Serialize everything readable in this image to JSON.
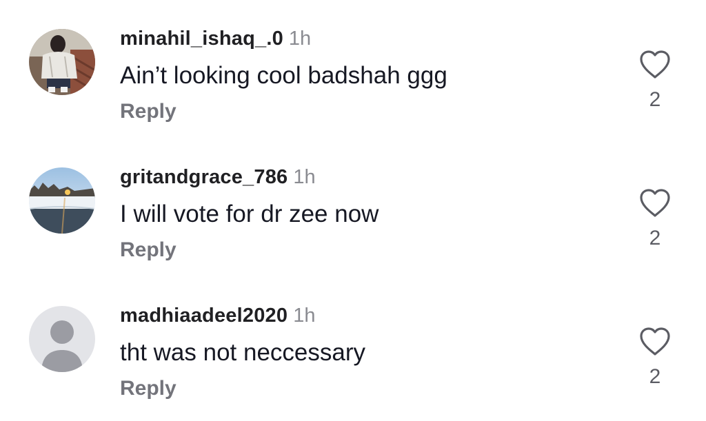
{
  "comments": [
    {
      "username": "minahil_ishaq_.0",
      "time": "1h",
      "text": "Ain’t looking cool badshah ggg",
      "reply_label": "Reply",
      "like_count": "2",
      "avatar_icon": "user-photo-avatar"
    },
    {
      "username": "gritandgrace_786",
      "time": "1h",
      "text": "I will vote for dr zee now",
      "reply_label": "Reply",
      "like_count": "2",
      "avatar_icon": "landscape-photo-avatar"
    },
    {
      "username": "madhiaadeel2020",
      "time": "1h",
      "text": "tht was not neccessary",
      "reply_label": "Reply",
      "like_count": "2",
      "avatar_icon": "default-user-avatar"
    }
  ],
  "colors": {
    "username": "#202023",
    "timestamp": "#8a8b91",
    "text": "#161823",
    "reply": "#73747b",
    "icon": "#5b5c63"
  }
}
